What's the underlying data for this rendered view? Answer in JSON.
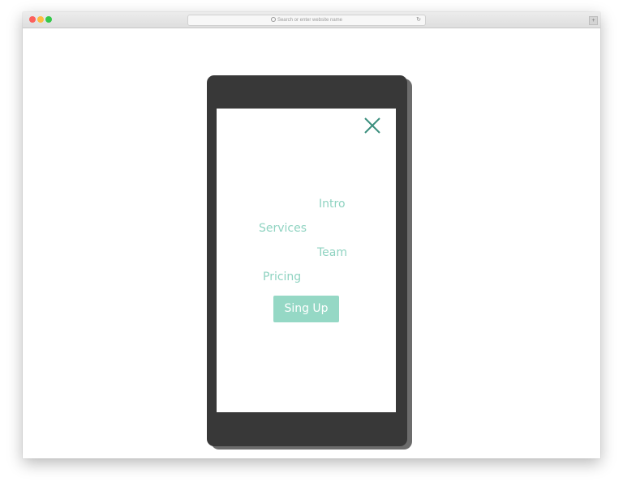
{
  "browser": {
    "address_bar_placeholder": "Search or enter website name",
    "traffic_lights": {
      "close_color": "#fc605c",
      "minimize_color": "#fdbc40",
      "zoom_color": "#34c84a"
    },
    "icons": {
      "search": "search-icon",
      "reload": "reload-icon",
      "tabs": "tabs-icon"
    }
  },
  "phone": {
    "body_color": "#383838",
    "accent_color": "#8fd3c1",
    "close_icon": "close-icon",
    "close_icon_color": "#3c8f7e",
    "menu": {
      "items": [
        {
          "label": "Intro"
        },
        {
          "label": "Services"
        },
        {
          "label": "Team"
        },
        {
          "label": "Pricing"
        }
      ],
      "signup_label": "Sing Up"
    }
  }
}
